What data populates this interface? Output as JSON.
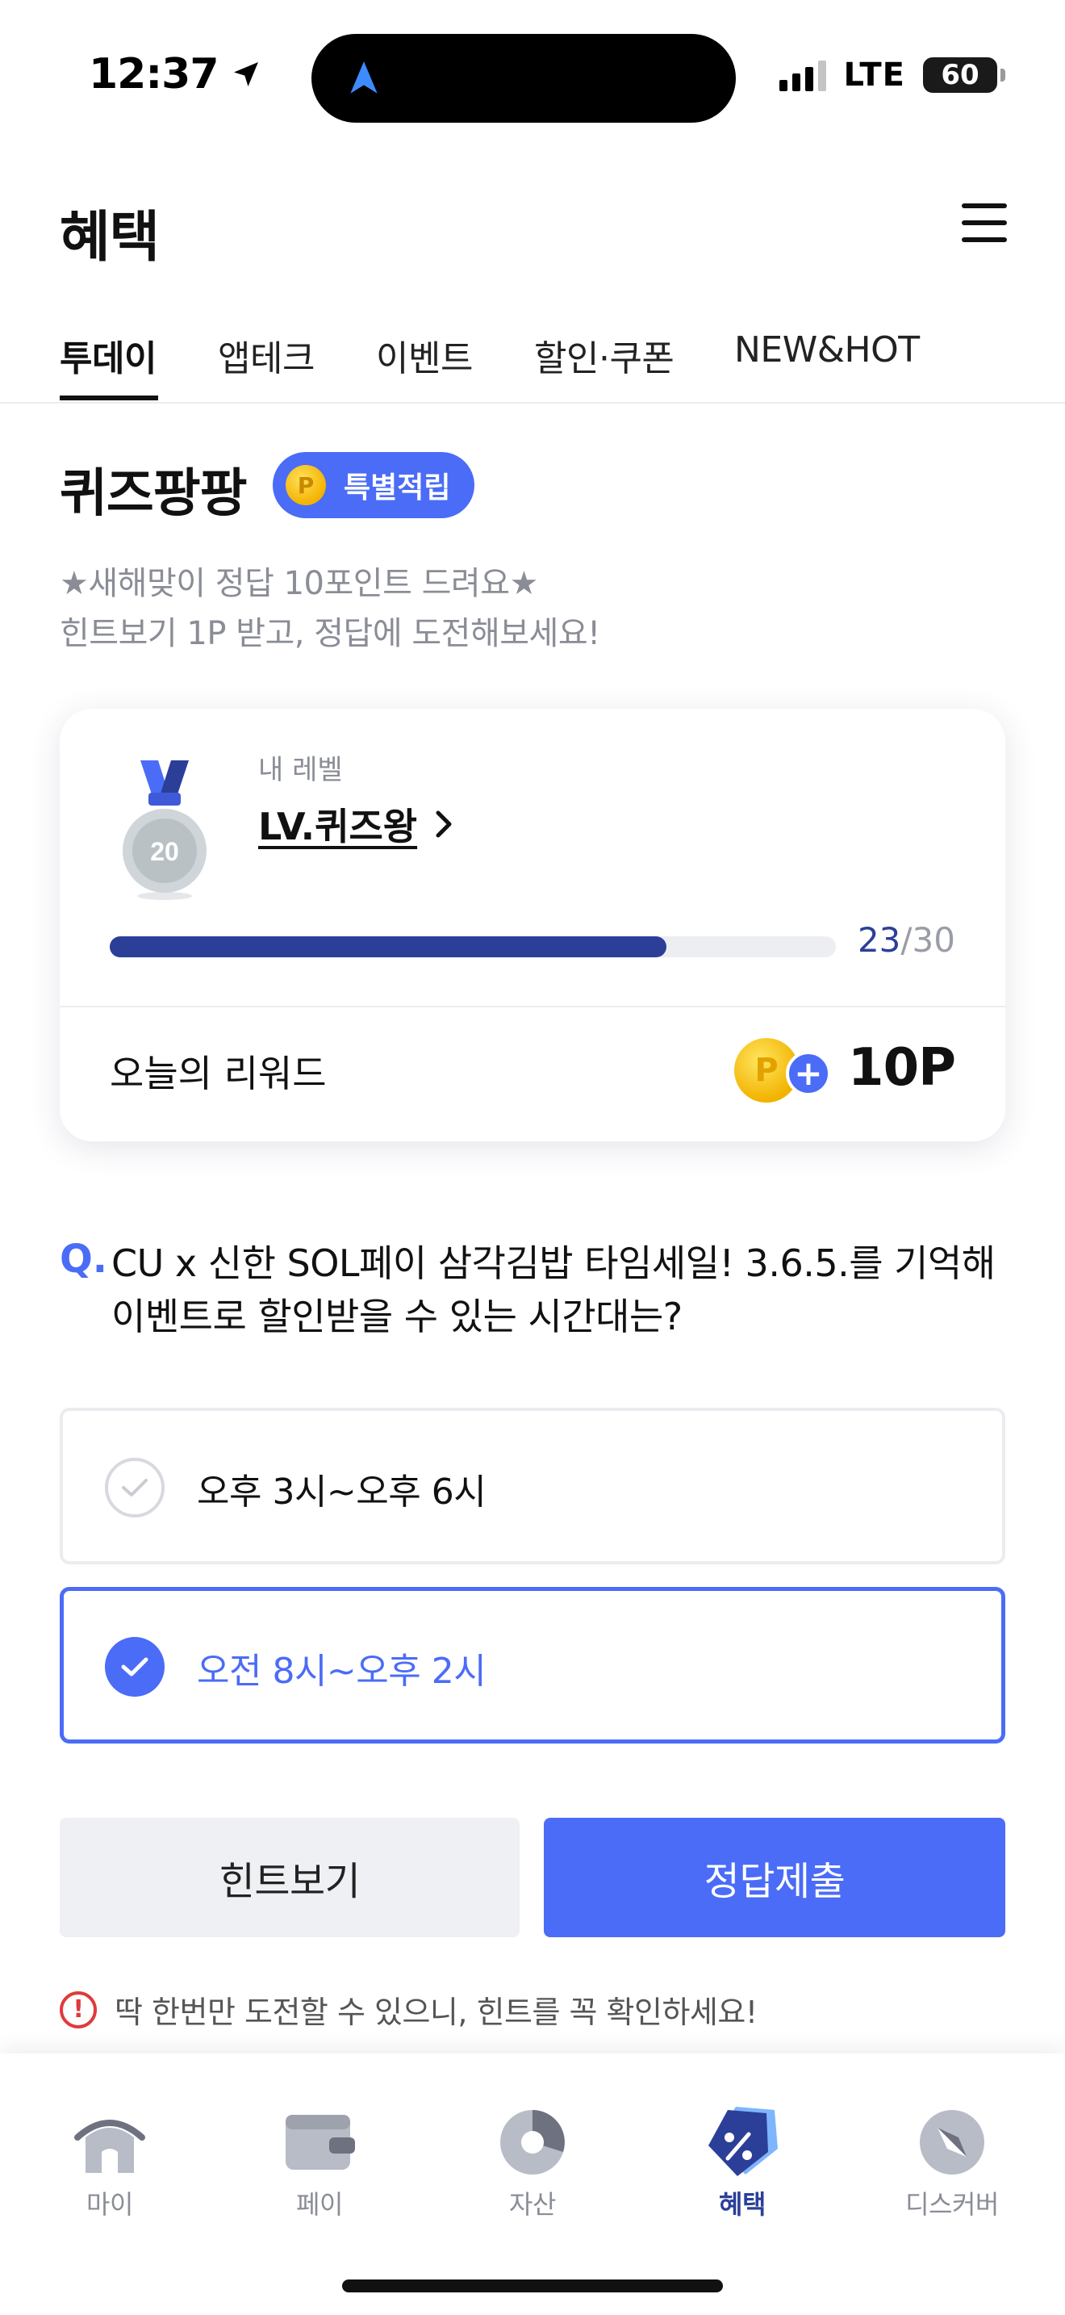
{
  "status_bar": {
    "time": "12:37",
    "network": "LTE",
    "battery": "60"
  },
  "header": {
    "title": "혜택"
  },
  "tabs": [
    {
      "label": "투데이",
      "active": true
    },
    {
      "label": "앱테크",
      "active": false
    },
    {
      "label": "이벤트",
      "active": false
    },
    {
      "label": "할인·쿠폰",
      "active": false
    },
    {
      "label": "NEW&HOT",
      "active": false
    }
  ],
  "quiz": {
    "title": "퀴즈팡팡",
    "badge_coin": "P",
    "badge_label": "특별적립",
    "subtitle_line1": "★새해맞이 정답 10포인트 드려요★",
    "subtitle_line2": "힌트보기 1P 받고, 정답에 도전해보세요!"
  },
  "level_card": {
    "caption": "내 레벨",
    "level_name": "LV.퀴즈왕",
    "medal_number": "20",
    "progress_current": "23",
    "progress_total": "/30",
    "progress_fraction": 0.767,
    "reward_label": "오늘의 리워드",
    "reward_coin": "P",
    "reward_value": "10P"
  },
  "question": {
    "mark": "Q.",
    "text": "CU x 신한 SOL페이 삼각김밥 타임세일! 3.6.5.를 기억해 이벤트로 할인받을 수 있는 시간대는?"
  },
  "options": [
    {
      "label": "오후 3시~오후 6시",
      "selected": false
    },
    {
      "label": "오전 8시~오후 2시",
      "selected": true
    }
  ],
  "buttons": {
    "hint": "힌트보기",
    "submit": "정답제출"
  },
  "warning": {
    "icon": "!",
    "text": "딱 한번만 도전할 수 있으니, 힌트를 꼭 확인하세요!"
  },
  "bottom_nav": [
    {
      "label": "마이",
      "icon": "home-icon",
      "active": false
    },
    {
      "label": "페이",
      "icon": "wallet-icon",
      "active": false
    },
    {
      "label": "자산",
      "icon": "pie-chart-icon",
      "active": false
    },
    {
      "label": "혜택",
      "icon": "discount-tag-icon",
      "active": true
    },
    {
      "label": "디스커버",
      "icon": "compass-icon",
      "active": false
    }
  ],
  "colors": {
    "accent": "#4a6cf7",
    "navy": "#2b3f99",
    "warning": "#e03a3a"
  }
}
